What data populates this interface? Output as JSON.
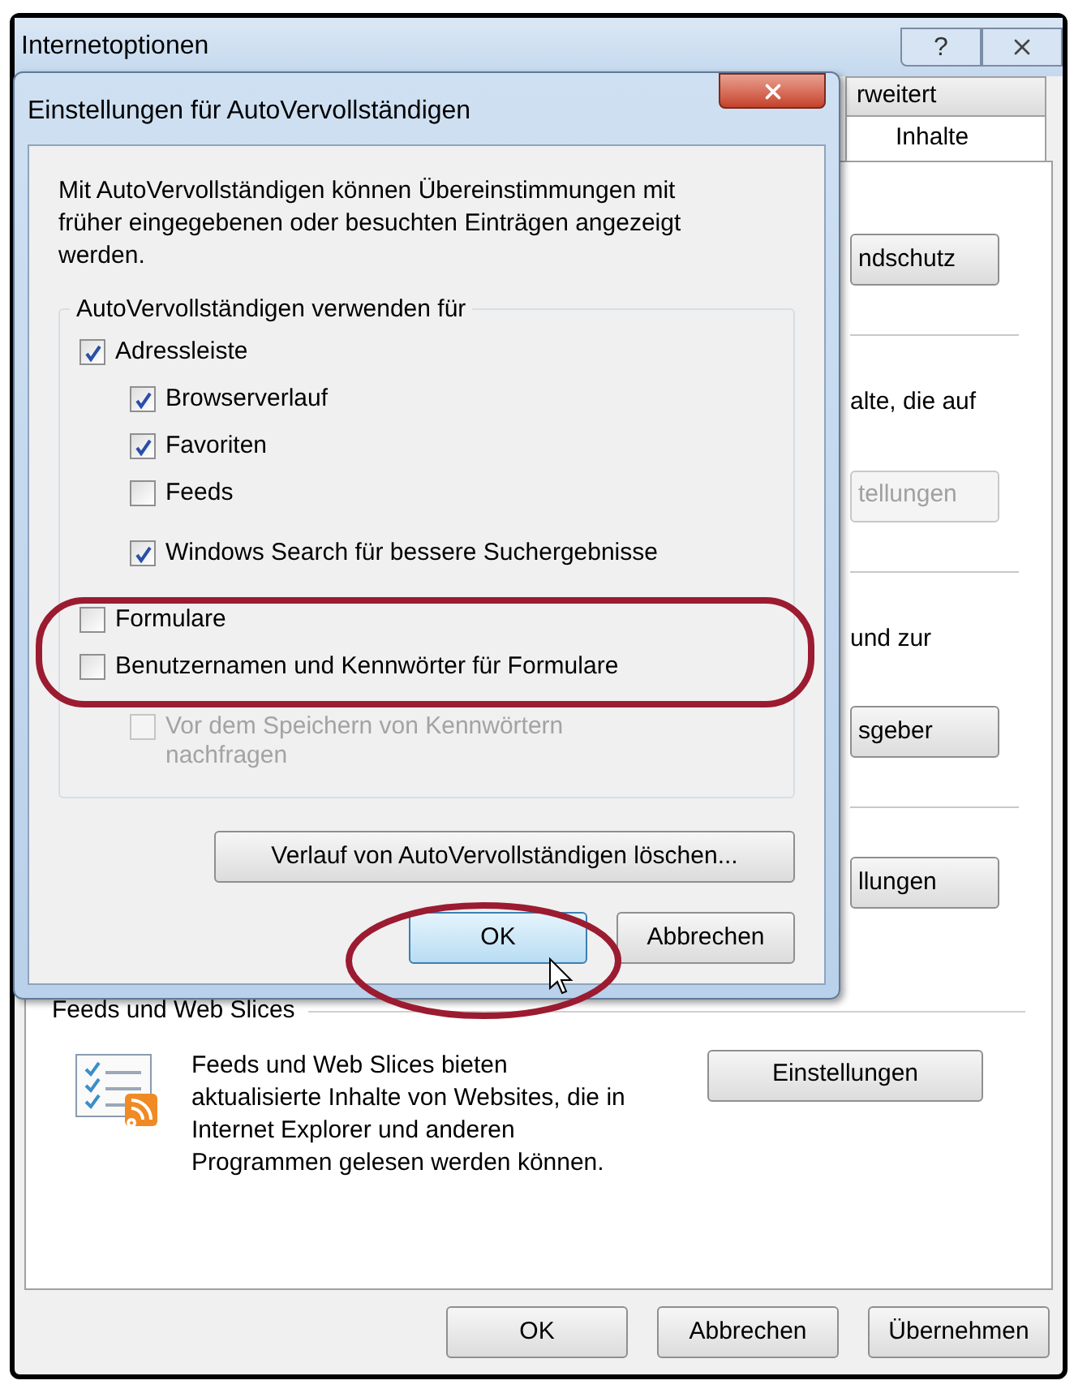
{
  "window": {
    "title": "Internetoptionen",
    "help": "?"
  },
  "tabs": [
    {
      "label": "rweitert",
      "selected": false
    },
    {
      "label": "Inhalte",
      "selected": true
    }
  ],
  "panel_items": [
    {
      "kind": "button",
      "label": "ndschutz",
      "disabled": false
    },
    {
      "kind": "divider"
    },
    {
      "kind": "text",
      "text": "alte, die auf"
    },
    {
      "kind": "button",
      "label": "tellungen",
      "disabled": true
    },
    {
      "kind": "divider"
    },
    {
      "kind": "text",
      "text": "und zur"
    },
    {
      "kind": "button",
      "label": "sgeber",
      "disabled": false
    },
    {
      "kind": "divider"
    },
    {
      "kind": "button",
      "label": "llungen",
      "disabled": false
    }
  ],
  "feeds_group": {
    "title": "Feeds und Web Slices",
    "description": "Feeds und Web Slices bieten aktualisierte Inhalte von Websites, die in Internet Explorer und anderen Programmen gelesen werden können.",
    "button": "Einstellungen"
  },
  "footer_buttons": [
    {
      "label": "OK"
    },
    {
      "label": "Abbrechen"
    },
    {
      "label": "Übernehmen"
    }
  ],
  "dialog": {
    "title": "Einstellungen für AutoVervollständigen",
    "description": "Mit AutoVervollständigen können Übereinstimmungen mit früher eingegebenen oder besuchten Einträgen angezeigt werden.",
    "group_title": "AutoVervollständigen verwenden für",
    "options": [
      {
        "label": "Adressleiste",
        "checked": true,
        "disabled": false,
        "children": [
          {
            "label": "Browserverlauf",
            "checked": true,
            "disabled": false
          },
          {
            "label": "Favoriten",
            "checked": true,
            "disabled": false
          },
          {
            "label": "Feeds",
            "checked": false,
            "disabled": false
          },
          {
            "label": "Windows Search für bessere Suchergebnisse",
            "checked": true,
            "disabled": false
          }
        ]
      },
      {
        "label": "Formulare",
        "checked": false,
        "disabled": false
      },
      {
        "label": "Benutzernamen und Kennwörter für Formulare",
        "checked": false,
        "disabled": false,
        "children": [
          {
            "label": "Vor dem Speichern von Kennwörtern nachfragen",
            "checked": false,
            "disabled": true
          }
        ]
      }
    ],
    "clear_button": "Verlauf von AutoVervollständigen löschen...",
    "buttons": [
      {
        "label": "OK",
        "default": true
      },
      {
        "label": "Abbrechen",
        "default": false
      }
    ]
  }
}
